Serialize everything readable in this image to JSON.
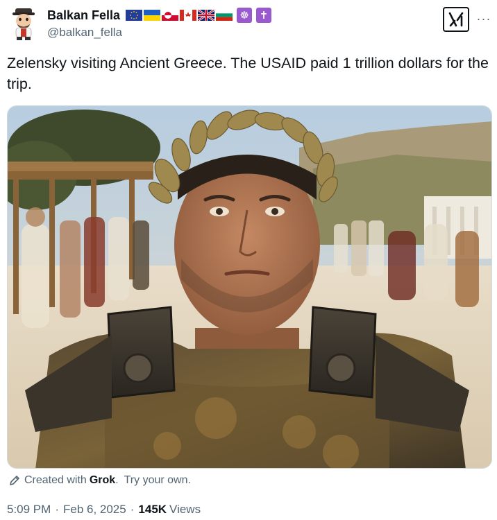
{
  "user": {
    "display_name": "Balkan Fella",
    "handle": "@balkan_fella",
    "name_emojis": [
      "eu-flag",
      "ukraine-flag",
      "greenland-flag",
      "canada-flag",
      "uk-flag",
      "bulgaria-flag",
      "dharma-wheel",
      "latin-cross"
    ],
    "dharma_glyph": "☸",
    "cross_glyph": "✝"
  },
  "actions": {
    "grok_icon": "grok-logo-icon",
    "more_label": "···"
  },
  "tweet": {
    "text": "Zelensky visiting Ancient Greece. The USAID paid 1 trillion dollars for the trip."
  },
  "media": {
    "description_icon": "ai-generated-image"
  },
  "credit": {
    "prefix": "Created with",
    "brand": "Grok",
    "suffix": ".",
    "cta": "Try your own."
  },
  "meta": {
    "time": "5:09 PM",
    "separator": "·",
    "date": "Feb 6, 2025",
    "views_count": "145K",
    "views_label": "Views"
  },
  "colors": {
    "text_primary": "#0f1419",
    "text_secondary": "#536471",
    "border": "#cfd9de",
    "emoji_purple": "#9b59d0"
  }
}
